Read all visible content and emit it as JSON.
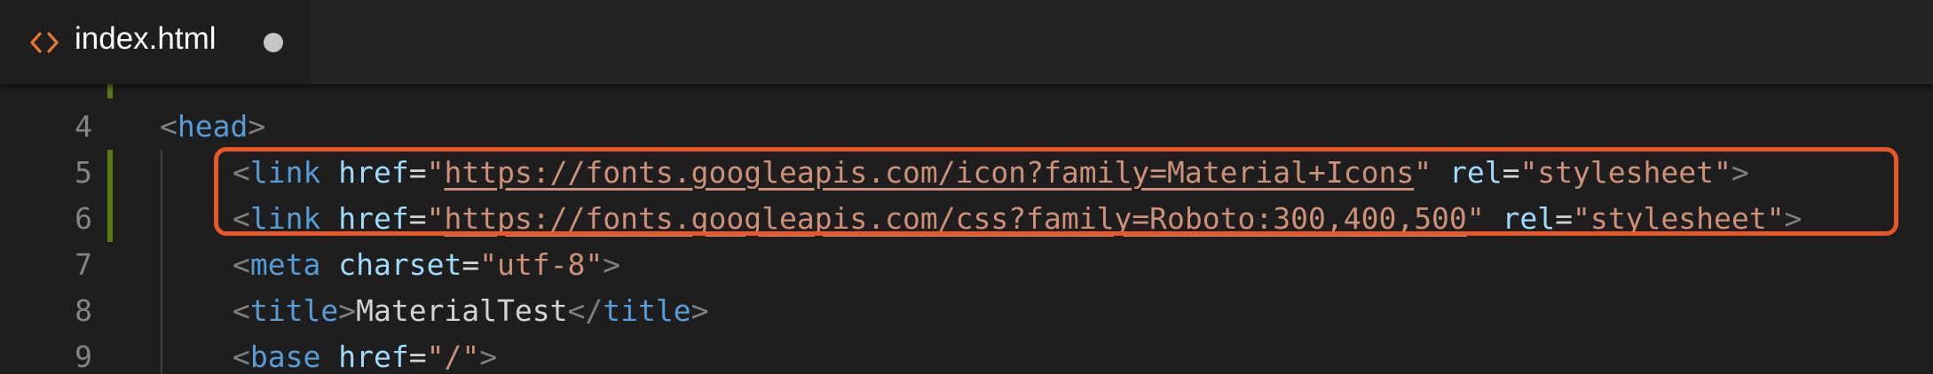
{
  "tab": {
    "filename": "index.html",
    "icon": "code-brackets-icon",
    "dirty_indicator": "unsaved-dot-icon"
  },
  "colors": {
    "editor_bg": "#1e1e1e",
    "tabbar_bg": "#252526",
    "tag": "#569cd6",
    "attribute": "#9cdcfe",
    "string": "#ce9178",
    "punctuation": "#808080",
    "gutter_modified": "#587c0c",
    "highlight_box": "#e9562a",
    "tab_icon": "#e37933"
  },
  "lines": [
    {
      "number": "4",
      "tokens": [
        {
          "t": "<",
          "c": "c-punct"
        },
        {
          "t": "head",
          "c": "c-tag"
        },
        {
          "t": ">",
          "c": "c-punct"
        }
      ]
    },
    {
      "number": "5",
      "tokens": [
        {
          "t": "<",
          "c": "c-punct"
        },
        {
          "t": "link",
          "c": "c-tag"
        },
        {
          "t": " ",
          "c": "c-text"
        },
        {
          "t": "href",
          "c": "c-attr"
        },
        {
          "t": "=",
          "c": "c-eq"
        },
        {
          "t": "\"",
          "c": "c-str"
        },
        {
          "t": "https://fonts.googleapis.com/icon?family=Material+Icons",
          "c": "c-url"
        },
        {
          "t": "\"",
          "c": "c-str"
        },
        {
          "t": " ",
          "c": "c-text"
        },
        {
          "t": "rel",
          "c": "c-attr"
        },
        {
          "t": "=",
          "c": "c-eq"
        },
        {
          "t": "\"stylesheet\"",
          "c": "c-str"
        },
        {
          "t": ">",
          "c": "c-punct"
        }
      ]
    },
    {
      "number": "6",
      "tokens": [
        {
          "t": "<",
          "c": "c-punct"
        },
        {
          "t": "link",
          "c": "c-tag"
        },
        {
          "t": " ",
          "c": "c-text"
        },
        {
          "t": "href",
          "c": "c-attr"
        },
        {
          "t": "=",
          "c": "c-eq"
        },
        {
          "t": "\"",
          "c": "c-str"
        },
        {
          "t": "https://fonts.googleapis.com/css?family=Roboto:300,400,500",
          "c": "c-url"
        },
        {
          "t": "\"",
          "c": "c-str"
        },
        {
          "t": " ",
          "c": "c-text"
        },
        {
          "t": "rel",
          "c": "c-attr"
        },
        {
          "t": "=",
          "c": "c-eq"
        },
        {
          "t": "\"stylesheet\"",
          "c": "c-str"
        },
        {
          "t": ">",
          "c": "c-punct"
        }
      ]
    },
    {
      "number": "7",
      "tokens": [
        {
          "t": "<",
          "c": "c-punct"
        },
        {
          "t": "meta",
          "c": "c-tag"
        },
        {
          "t": " ",
          "c": "c-text"
        },
        {
          "t": "charset",
          "c": "c-attr"
        },
        {
          "t": "=",
          "c": "c-eq"
        },
        {
          "t": "\"utf-8\"",
          "c": "c-str"
        },
        {
          "t": ">",
          "c": "c-punct"
        }
      ]
    },
    {
      "number": "8",
      "tokens": [
        {
          "t": "<",
          "c": "c-punct"
        },
        {
          "t": "title",
          "c": "c-tag"
        },
        {
          "t": ">",
          "c": "c-punct"
        },
        {
          "t": "MaterialTest",
          "c": "c-text"
        },
        {
          "t": "</",
          "c": "c-punct"
        },
        {
          "t": "title",
          "c": "c-tag"
        },
        {
          "t": ">",
          "c": "c-punct"
        }
      ]
    },
    {
      "number": "9",
      "tokens": [
        {
          "t": "<",
          "c": "c-punct"
        },
        {
          "t": "base",
          "c": "c-tag"
        },
        {
          "t": " ",
          "c": "c-text"
        },
        {
          "t": "href",
          "c": "c-attr"
        },
        {
          "t": "=",
          "c": "c-eq"
        },
        {
          "t": "\"/\"",
          "c": "c-str"
        },
        {
          "t": ">",
          "c": "c-punct"
        }
      ]
    }
  ]
}
